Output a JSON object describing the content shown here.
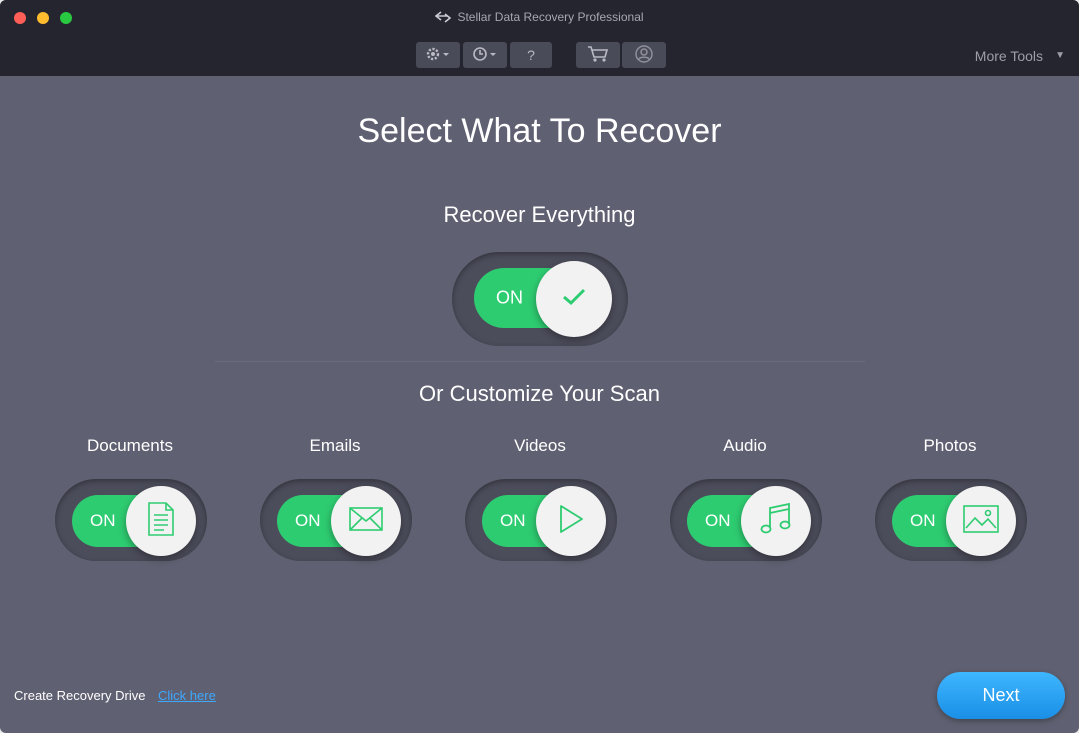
{
  "window": {
    "title": "Stellar Data Recovery Professional",
    "more_tools": "More Tools"
  },
  "toolbar": {
    "items": [
      "gear-icon",
      "history-icon",
      "help-icon",
      "cart-icon",
      "user-icon"
    ],
    "help_label": "?"
  },
  "main": {
    "heading": "Select What To Recover",
    "recover_everything": {
      "label": "Recover Everything",
      "state": "ON"
    },
    "customize_label": "Or Customize Your Scan",
    "categories": [
      {
        "name": "Documents",
        "state": "ON",
        "icon": "document-icon"
      },
      {
        "name": "Emails",
        "state": "ON",
        "icon": "email-icon"
      },
      {
        "name": "Videos",
        "state": "ON",
        "icon": "play-icon"
      },
      {
        "name": "Audio",
        "state": "ON",
        "icon": "music-icon"
      },
      {
        "name": "Photos",
        "state": "ON",
        "icon": "image-icon"
      }
    ]
  },
  "footer": {
    "create_recovery_drive": "Create Recovery Drive",
    "click_here": "Click here",
    "next": "Next"
  },
  "colors": {
    "background": "#5f6071",
    "titlebar": "#25252f",
    "toggle_on": "#2ecc71",
    "accent_blue": "#1a8fe6"
  }
}
